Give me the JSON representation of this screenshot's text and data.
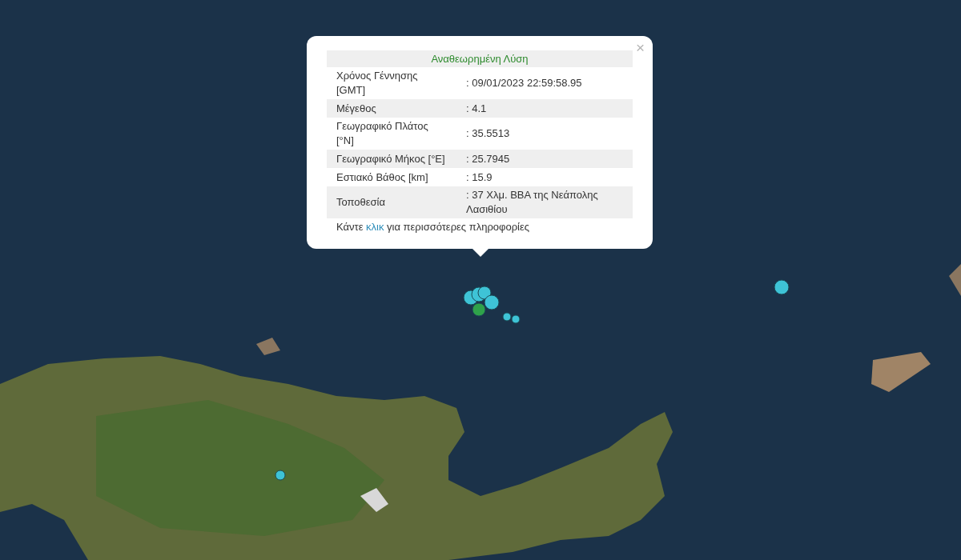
{
  "popup": {
    "close": "×",
    "title": "Αναθεωρημένη Λύση",
    "rows": [
      {
        "label": "Χρόνος Γέννησης [GMT]",
        "value": ": 09/01/2023 22:59:58.95"
      },
      {
        "label": "Μέγεθος",
        "value": ": 4.1"
      },
      {
        "label": "Γεωγραφικό Πλάτος [°N]",
        "value": ": 35.5513"
      },
      {
        "label": "Γεωγραφικό Μήκος [°E]",
        "value": ": 25.7945"
      },
      {
        "label": "Εστιακό Βάθος [km]",
        "value": ": 15.9"
      },
      {
        "label": "Τοποθεσία",
        "value": ": 37 Χλμ. ΒΒΑ της Νεάπολης Λασιθίου"
      }
    ],
    "footer": {
      "before": "Κάντε",
      "link": "κλικ",
      "after": "για περισσότερες πληροφορίες"
    }
  },
  "markers": [
    {
      "color": "#3ec3d6"
    },
    {
      "color": "#3ec3d6"
    },
    {
      "color": "#3ec3d6"
    },
    {
      "color": "#3ec3d6"
    },
    {
      "color": "#2fa24a"
    },
    {
      "color": "#3ec3d6"
    },
    {
      "color": "#3ec3d6"
    },
    {
      "color": "#3ec3d6"
    },
    {
      "color": "#3ec3d6"
    }
  ]
}
